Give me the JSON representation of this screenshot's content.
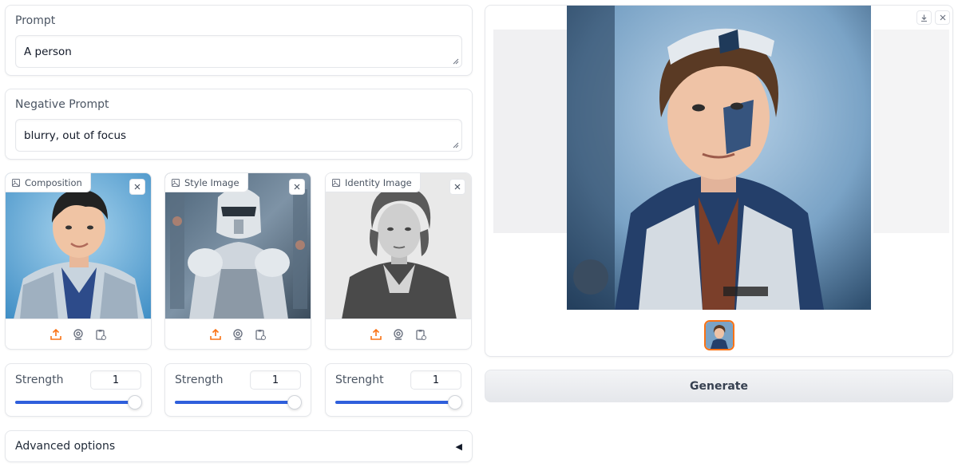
{
  "prompt": {
    "label": "Prompt",
    "value": "A person"
  },
  "negative_prompt": {
    "label": "Negative Prompt",
    "value": "blurry, out of focus"
  },
  "images": [
    {
      "label": "Composition"
    },
    {
      "label": "Style Image"
    },
    {
      "label": "Identity Image"
    }
  ],
  "sliders": [
    {
      "label": "Strength",
      "value": "1",
      "fraction": 1.0
    },
    {
      "label": "Strength",
      "value": "1",
      "fraction": 1.0
    },
    {
      "label": "Strenght",
      "value": "1",
      "fraction": 1.0
    }
  ],
  "advanced": {
    "label": "Advanced options",
    "arrow": "◀"
  },
  "generate": {
    "label": "Generate"
  },
  "colors": {
    "accent": "#f97316",
    "slider": "#2f5fdc"
  }
}
